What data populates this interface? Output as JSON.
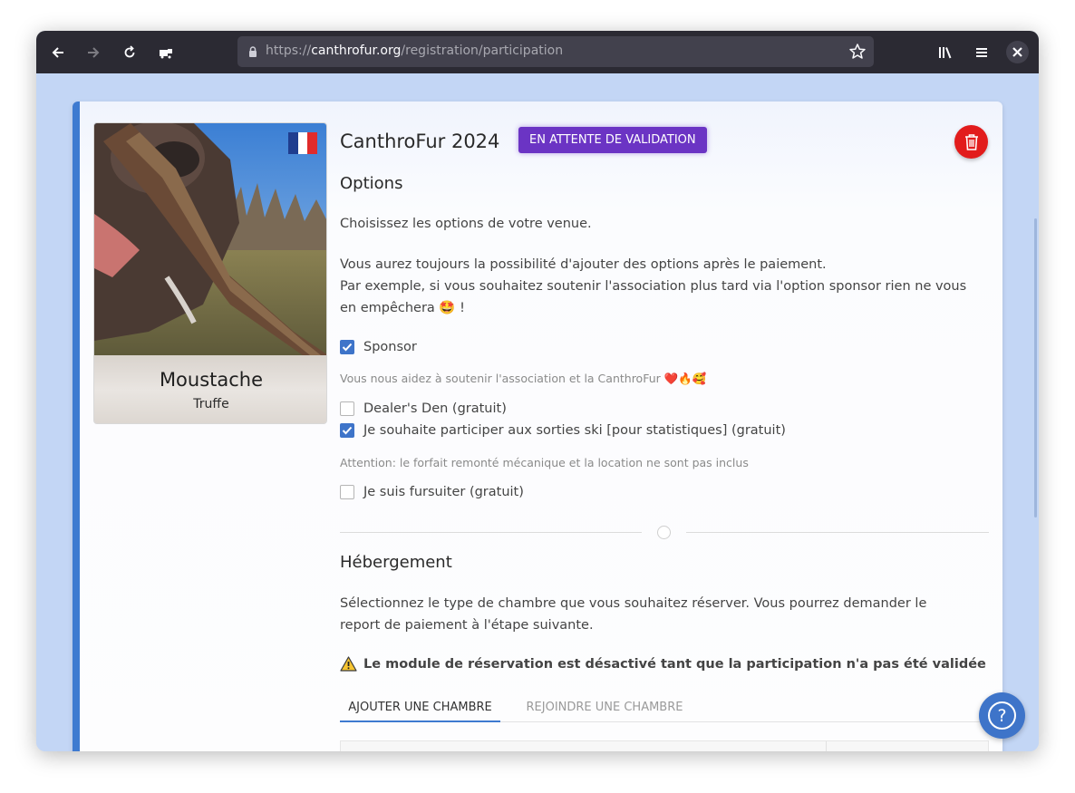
{
  "browser": {
    "url_scheme": "https://",
    "url_host": "canthrofur.org",
    "url_path": "/registration/participation",
    "icons": [
      "back-arrow-icon",
      "forward-arrow-icon",
      "reload-icon",
      "devtools-icon",
      "lock-icon",
      "star-icon",
      "library-icon",
      "menu-icon",
      "close-icon"
    ]
  },
  "profile": {
    "name": "Moustache",
    "species": "Truffe",
    "flag_icon": "france-flag-icon"
  },
  "event": {
    "title": "CanthroFur 2024",
    "status": "EN ATTENTE DE VALIDATION",
    "status_color": "#6b34c4",
    "delete_color": "#e21c1c"
  },
  "options": {
    "heading": "Options",
    "intro": "Choisissez les options de votre venue.",
    "note_line1": "Vous aurez toujours la possibilité d'ajouter des options après le paiement.",
    "note_line2": "Par exemple, si vous souhaitez soutenir l'association plus tard via l'option sponsor rien ne vous en empêchera 🤩 !",
    "items": [
      {
        "label": "Sponsor",
        "checked": true,
        "help": "Vous nous aidez à soutenir l'association et la CanthroFur ❤️🔥🥰"
      },
      {
        "label": "Dealer's Den (gratuit)",
        "checked": false,
        "help": ""
      },
      {
        "label": "Je souhaite participer aux sorties ski [pour statistiques] (gratuit)",
        "checked": true,
        "help": "Attention: le forfait remonté mécanique et la location ne sont pas inclus"
      },
      {
        "label": "Je suis fursuiter (gratuit)",
        "checked": false,
        "help": ""
      }
    ]
  },
  "housing": {
    "heading": "Hébergement",
    "intro": "Sélectionnez le type de chambre que vous souhaitez réserver. Vous pourrez demander le report de paiement à l'étape suivante.",
    "warning": "Le module de réservation est désactivé tant que la participation n'a pas été validée",
    "tabs": [
      {
        "label": "AJOUTER UNE CHAMBRE",
        "active": true
      },
      {
        "label": "REJOINDRE UNE CHAMBRE",
        "active": false
      }
    ]
  },
  "help_icon": "help-icon",
  "accent_color": "#3e7ad0"
}
